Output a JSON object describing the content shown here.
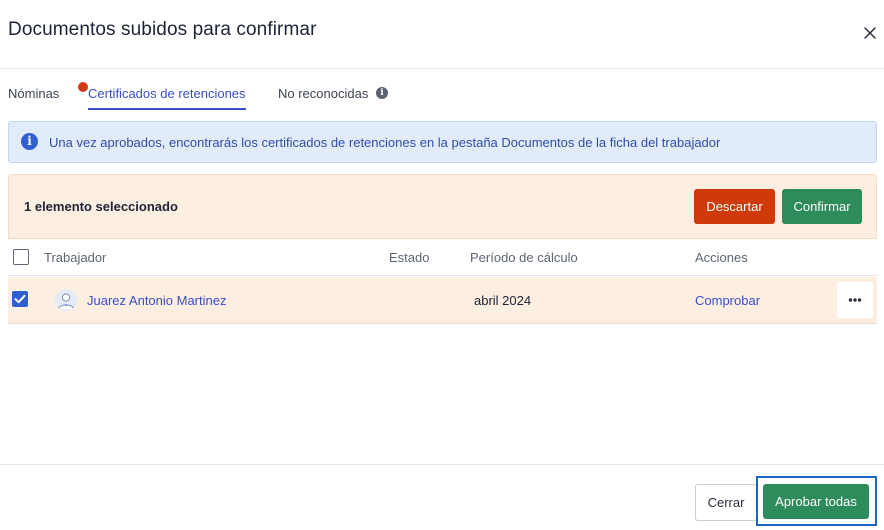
{
  "modal": {
    "title": "Documentos subidos para confirmar",
    "close_icon": "close-icon"
  },
  "tabs": [
    {
      "label": "Nóminas",
      "active": false
    },
    {
      "label": "Certificados de retenciones",
      "active": true,
      "has_notification_dot": true
    },
    {
      "label": "No reconocidas",
      "active": false,
      "icon": "info-icon"
    }
  ],
  "banner": {
    "icon": "info-icon",
    "text": "Una vez aprobados, encontrarás los certificados de retenciones en la pestaña Documentos de la ficha del trabajador"
  },
  "selection_bar": {
    "text": "1 elemento seleccionado",
    "discard_label": "Descartar",
    "confirm_label": "Confirmar"
  },
  "table": {
    "columns": [
      "Trabajador",
      "Estado",
      "Período de cálculo",
      "Acciones"
    ],
    "rows": [
      {
        "checked": true,
        "worker": "Juarez Antonio Martinez",
        "estado": "",
        "periodo": "abril 2024",
        "accion": "Comprobar",
        "more_icon": "more-horizontal-icon"
      }
    ]
  },
  "footer": {
    "close_label": "Cerrar",
    "approve_all_label": "Aprobar todas"
  },
  "colors": {
    "accent": "#3b4fc4",
    "danger": "#cf3a08",
    "success": "#2e8b5c",
    "selection_bg": "#fdeee2",
    "info_bg": "#e2ebfa"
  }
}
